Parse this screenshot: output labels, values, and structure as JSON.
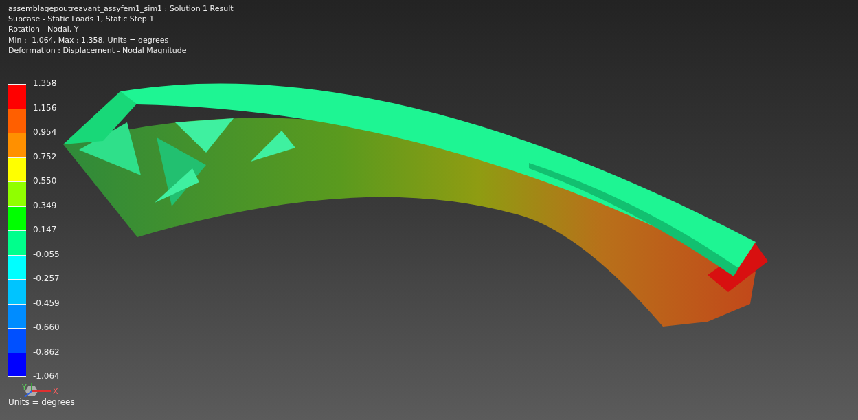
{
  "header": {
    "lines": [
      "assemblagepoutreavant_assyfem1_sim1 : Solution 1 Result",
      "Subcase - Static Loads 1, Static Step 1",
      "Rotation - Nodal, Y",
      "Min : -1.064, Max : 1.358, Units = degrees",
      "Deformation : Displacement - Nodal Magnitude"
    ]
  },
  "legend": {
    "bands": [
      {
        "color": "#ff0000"
      },
      {
        "color": "#ff5f00"
      },
      {
        "color": "#ff9000"
      },
      {
        "color": "#ffff00"
      },
      {
        "color": "#90ff00"
      },
      {
        "color": "#00ff00"
      },
      {
        "color": "#00ff8c"
      },
      {
        "color": "#00ffff"
      },
      {
        "color": "#00c4ff"
      },
      {
        "color": "#008cff"
      },
      {
        "color": "#0050ff"
      },
      {
        "color": "#0000ff"
      }
    ],
    "labels": [
      "1.358",
      "1.156",
      "0.954",
      "0.752",
      "0.550",
      "0.349",
      "0.147",
      "-0.055",
      "-0.257",
      "-0.459",
      "-0.660",
      "-0.862",
      "-1.064"
    ],
    "units": "Units = degrees"
  },
  "triad": {
    "x_label": "X",
    "y_label": "Y"
  }
}
